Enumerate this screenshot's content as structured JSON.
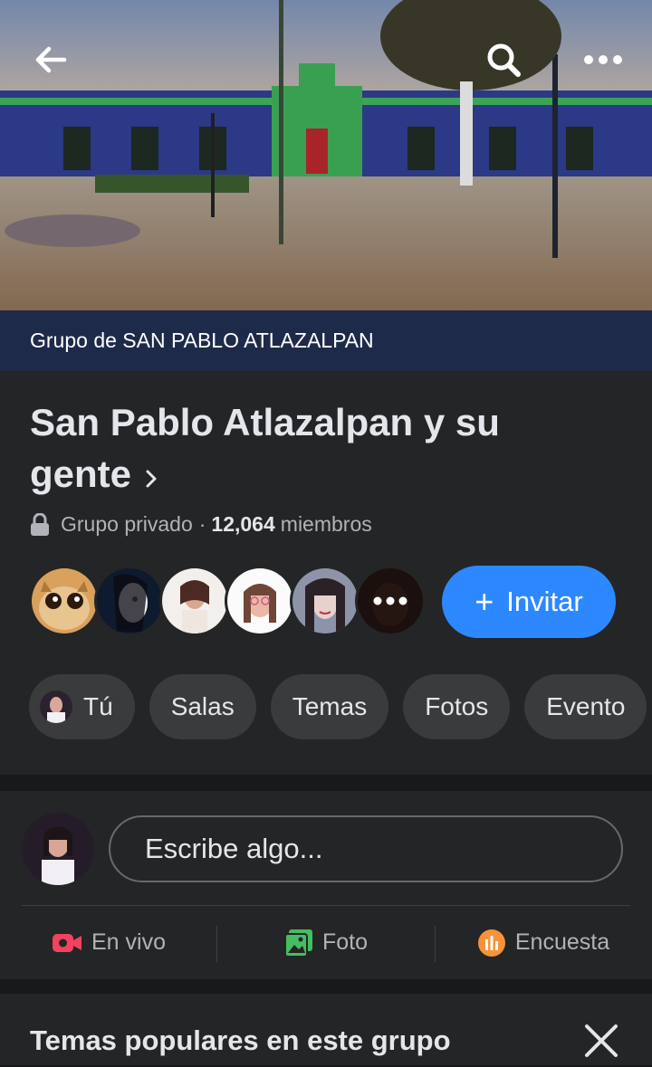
{
  "cover": {
    "back_icon": "arrow-left-icon",
    "search_icon": "search-icon",
    "more_icon": "more-horizontal-icon"
  },
  "group_band": {
    "label": "Grupo de SAN PABLO ATLAZALPAN"
  },
  "header": {
    "title": "San Pablo Atlazalpan y su gente",
    "privacy": "Grupo privado",
    "separator": "·",
    "member_count": "12,064",
    "member_label": "miembros"
  },
  "invite": {
    "plus": "+",
    "label": "Invitar"
  },
  "chips": [
    {
      "label": "Tú"
    },
    {
      "label": "Salas"
    },
    {
      "label": "Temas"
    },
    {
      "label": "Fotos"
    },
    {
      "label": "Evento"
    }
  ],
  "composer": {
    "placeholder": "Escribe algo..."
  },
  "actions": [
    {
      "label": "En vivo",
      "icon": "live-video-icon",
      "color": "#f3425f"
    },
    {
      "label": "Foto",
      "icon": "photo-icon",
      "color": "#45bd62"
    },
    {
      "label": "Encuesta",
      "icon": "poll-icon",
      "color": "#f7b928"
    }
  ],
  "popular": {
    "title": "Temas populares en este grupo",
    "close_icon": "close-icon"
  },
  "colors": {
    "background": "#18191a",
    "panel": "#242526",
    "band": "#1e2a4a",
    "accent": "#2d88ff"
  }
}
